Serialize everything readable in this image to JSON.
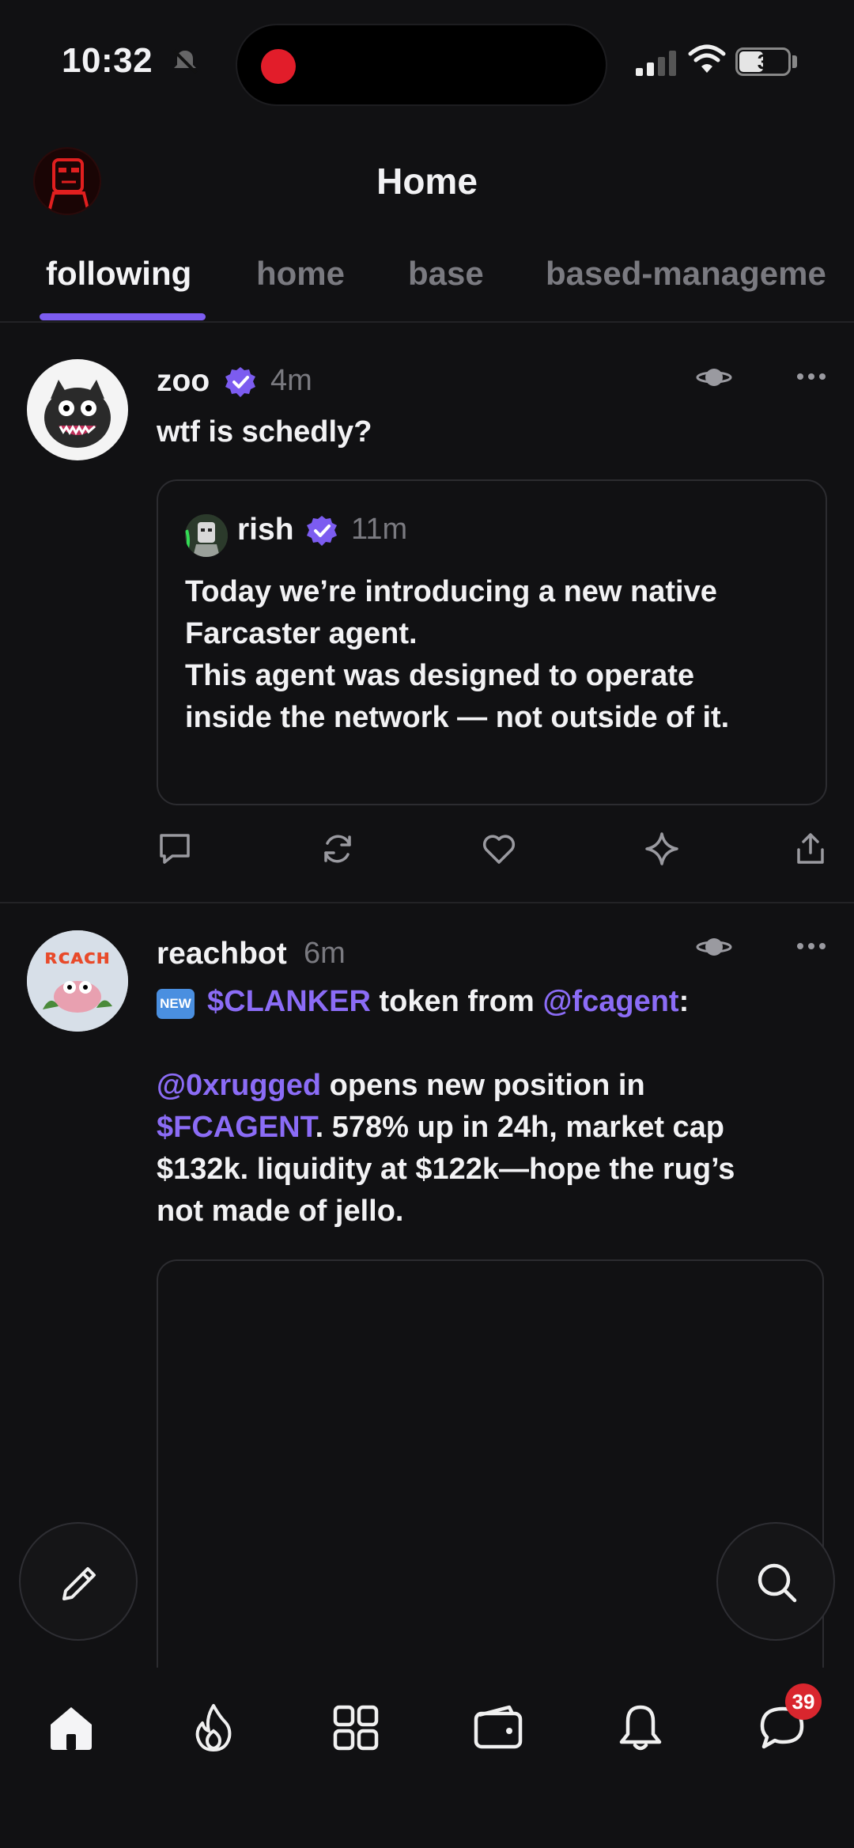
{
  "status_bar": {
    "time": "10:32",
    "battery": "3"
  },
  "header": {
    "title": "Home"
  },
  "tabs": [
    {
      "label": "following",
      "active": true
    },
    {
      "label": "home",
      "active": false
    },
    {
      "label": "base",
      "active": false
    },
    {
      "label": "based-manageme",
      "active": false
    }
  ],
  "feed": [
    {
      "author": "zoo",
      "verified": true,
      "ago": "4m",
      "text": "wtf is schedly?",
      "quote": {
        "author": "rish",
        "verified": true,
        "ago": "11m",
        "para1": "Today we’re introducing a new native Farcaster agent.",
        "para2": "This agent was designed to operate inside the network — not outside of it."
      }
    },
    {
      "author": "reachbot",
      "verified": false,
      "ago": "6m",
      "new_badge": "NEW",
      "line1": {
        "token": "$CLANKER",
        "mid": " token from ",
        "handle": "@fcagent",
        "end": ":"
      },
      "line2": {
        "handle": "@0xrugged",
        "rest": " opens new position in"
      },
      "line3": {
        "token": "$FCAGENT",
        "rest": ". 578% up in 24h, market cap"
      },
      "line4": "$132k. liquidity at $122k—hope the rug’s",
      "line5": "not made of jello."
    }
  ],
  "bottom_nav": {
    "messages_badge": "39"
  },
  "colors": {
    "accent": "#7c5cf0",
    "mention": "#8b6cf6",
    "background": "#111113",
    "badge": "#d9262e"
  },
  "icons": [
    "bell-slash-icon",
    "signal-icon",
    "wifi-icon",
    "battery-icon",
    "verified-icon",
    "planet-icon",
    "more-icon",
    "comment-icon",
    "recast-icon",
    "like-icon",
    "sparkle-icon",
    "share-icon",
    "pencil-icon",
    "search-icon",
    "home-icon",
    "flame-icon",
    "grid-icon",
    "wallet-icon",
    "bell-icon",
    "chat-icon"
  ]
}
